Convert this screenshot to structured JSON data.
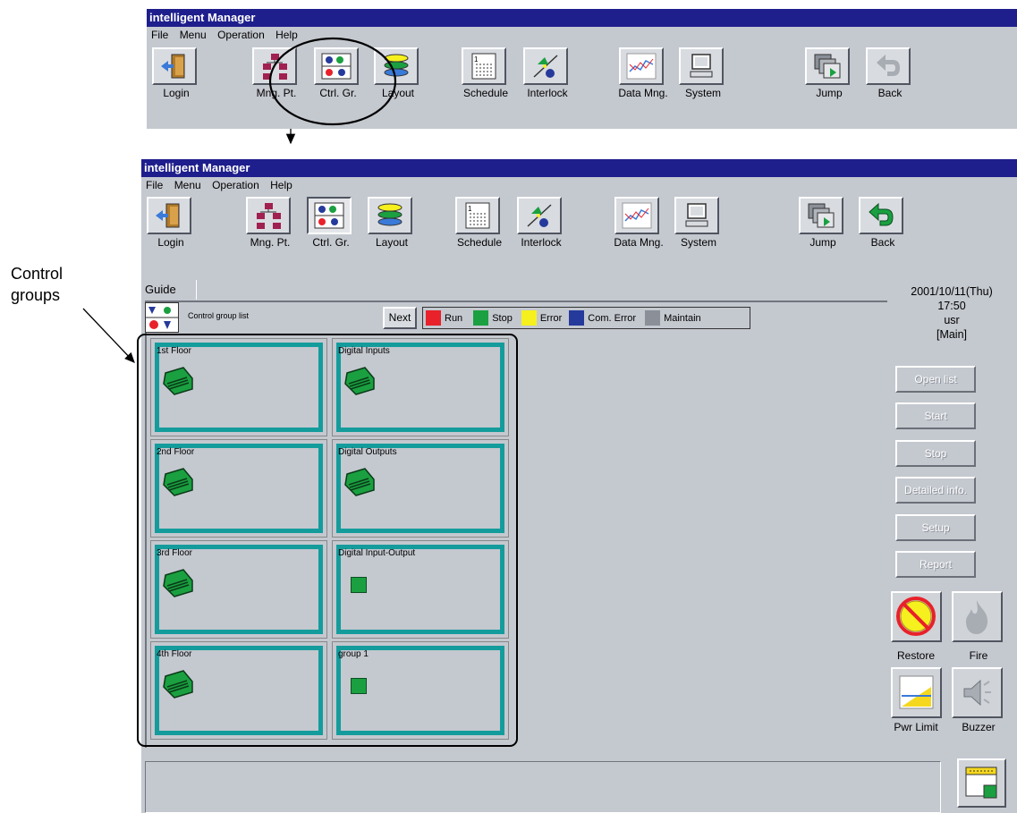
{
  "window_title": "intelligent Manager",
  "menu": [
    "File",
    "Menu",
    "Operation",
    "Help"
  ],
  "toolbar": {
    "login": "Login",
    "mng_pt": "Mng. Pt.",
    "ctrl_gr": "Ctrl. Gr.",
    "layout": "Layout",
    "schedule": "Schedule",
    "interlock": "Interlock",
    "data_mng": "Data Mng.",
    "system": "System",
    "jump": "Jump",
    "back": "Back"
  },
  "annotation": {
    "callout_line1": "Control",
    "callout_line2": "groups"
  },
  "guide_tab": "Guide",
  "control_group_list_label": "Control group list",
  "next_button": "Next",
  "legend": [
    {
      "label": "Run",
      "color": "#e8212a"
    },
    {
      "label": "Stop",
      "color": "#1aa040"
    },
    {
      "label": "Error",
      "color": "#f5f01e"
    },
    {
      "label": "Com. Error",
      "color": "#263a9c"
    },
    {
      "label": "Maintain",
      "color": "#8a8f98"
    }
  ],
  "groups": [
    {
      "name": "1st Floor",
      "icon": "air-conditioner-icon"
    },
    {
      "name": "Digital Inputs",
      "icon": "air-conditioner-icon"
    },
    {
      "name": "2nd Floor",
      "icon": "air-conditioner-icon"
    },
    {
      "name": "Digital Outputs",
      "icon": "air-conditioner-icon"
    },
    {
      "name": "3rd Floor",
      "icon": "air-conditioner-icon"
    },
    {
      "name": "Digital Input-Output",
      "icon": "green-status-square"
    },
    {
      "name": "4th Floor",
      "icon": "air-conditioner-icon"
    },
    {
      "name": "group 1",
      "icon": "green-status-square"
    }
  ],
  "info": {
    "date": "2001/10/11(Thu)",
    "time": "17:50",
    "user": "usr",
    "mode": "[Main]"
  },
  "side_buttons": {
    "open_list": "Open list",
    "start": "Start",
    "stop": "Stop",
    "detailed_info": "Detailed info.",
    "setup": "Setup",
    "report": "Report"
  },
  "bottom_buttons": {
    "restore": "Restore",
    "fire": "Fire",
    "pwr_limit": "Pwr Limit",
    "buzzer": "Buzzer"
  }
}
